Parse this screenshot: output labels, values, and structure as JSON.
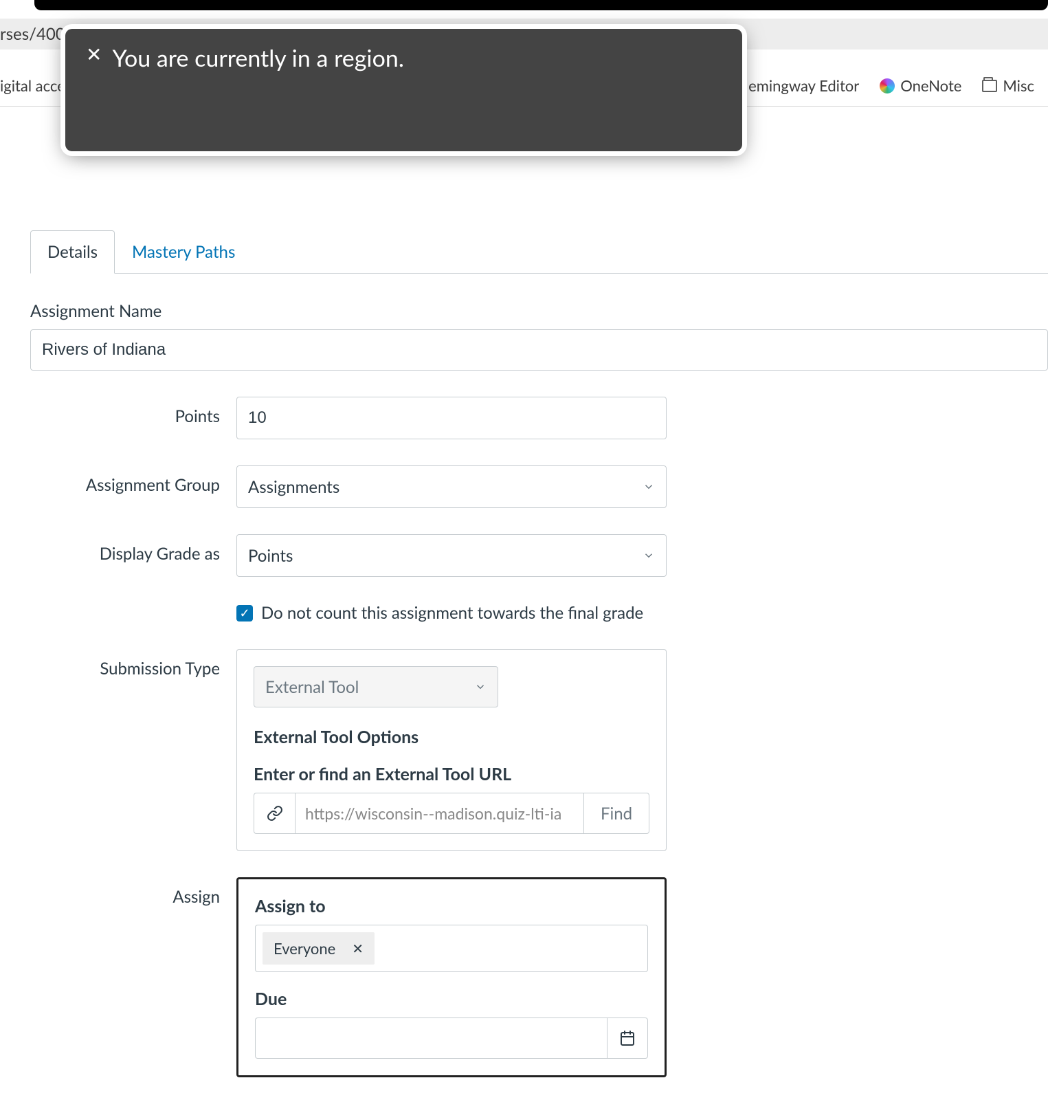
{
  "browser": {
    "url_fragment": "rses/400",
    "bookmarks": {
      "left_fragment": "igital acce",
      "hemingway_fragment": "emingway Editor",
      "onenote": "OneNote",
      "misc": "Misc"
    }
  },
  "toast": {
    "message": "You are currently in a region."
  },
  "tabs": {
    "details": "Details",
    "mastery_paths": "Mastery Paths"
  },
  "form": {
    "assignment_name_label": "Assignment Name",
    "assignment_name_value": "Rivers of Indiana",
    "points_label": "Points",
    "points_value": "10",
    "assignment_group_label": "Assignment Group",
    "assignment_group_value": "Assignments",
    "display_grade_label": "Display Grade as",
    "display_grade_value": "Points",
    "do_not_count_label": "Do not count this assignment towards the final grade",
    "submission_type_label": "Submission Type",
    "submission_type_value": "External Tool",
    "external_tool_options_heading": "External Tool Options",
    "external_tool_url_heading": "Enter or find an External Tool URL",
    "external_tool_url_value": "https://wisconsin--madison.quiz-lti-ia",
    "find_button": "Find",
    "assign_label": "Assign",
    "assign_to_heading": "Assign to",
    "assign_to_tag": "Everyone",
    "due_heading": "Due"
  }
}
